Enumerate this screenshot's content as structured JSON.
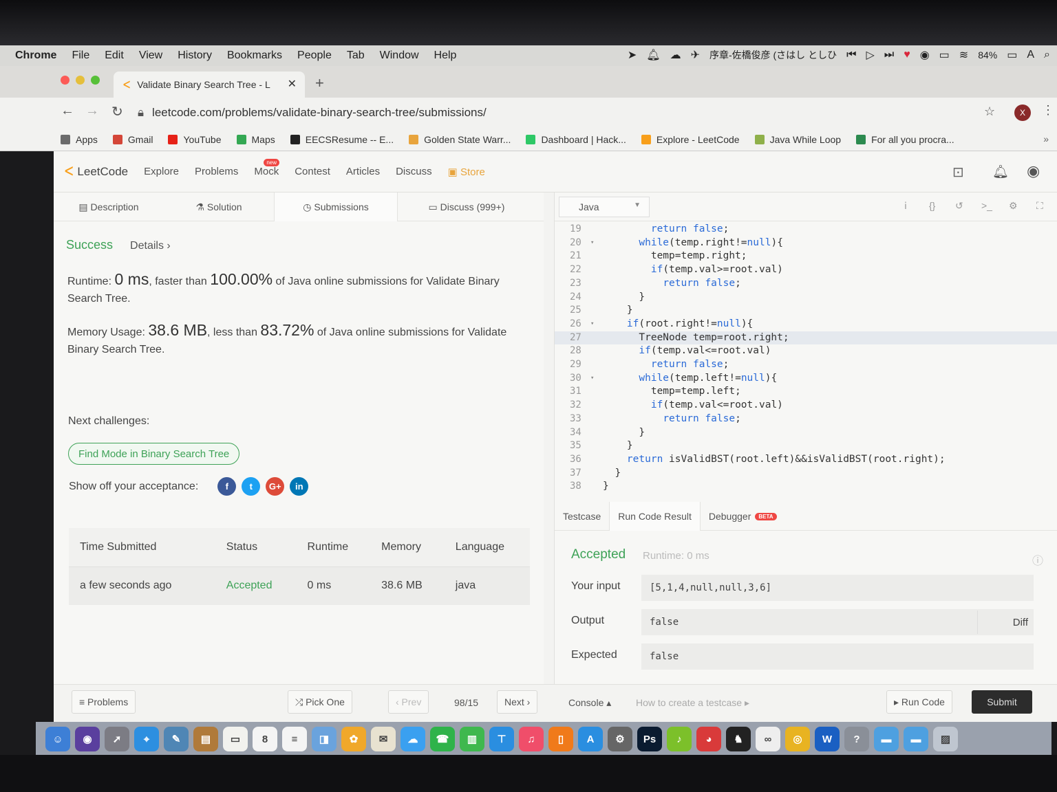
{
  "menubar": {
    "app": "Chrome",
    "items": [
      "File",
      "Edit",
      "View",
      "History",
      "Bookmarks",
      "People",
      "Tab",
      "Window",
      "Help"
    ],
    "now_playing": "序章-佐橋俊彦 (さはし としひ",
    "battery": "84%"
  },
  "browser": {
    "tab_title": "Validate Binary Search Tree - L",
    "tab_close": "✕",
    "url": "leetcode.com/problems/validate-binary-search-tree/submissions/",
    "profile_initial": "X",
    "bookmarks": [
      {
        "label": "Apps",
        "color": "#6b6b6b"
      },
      {
        "label": "Gmail",
        "color": "#d44638"
      },
      {
        "label": "YouTube",
        "color": "#e62117"
      },
      {
        "label": "Maps",
        "color": "#34a853"
      },
      {
        "label": "EECSResume -- E...",
        "color": "#222222"
      },
      {
        "label": "Golden State Warr...",
        "color": "#e8a43c"
      },
      {
        "label": "Dashboard | Hack...",
        "color": "#2ec866"
      },
      {
        "label": "Explore - LeetCode",
        "color": "#f89f1b"
      },
      {
        "label": "Java While Loop",
        "color": "#8fb04a"
      },
      {
        "label": "For all you procra...",
        "color": "#2c8a4f"
      }
    ],
    "bookmarks_overflow": "»"
  },
  "leetcode": {
    "logo": "LeetCode",
    "nav": [
      "Explore",
      "Problems",
      "Mock",
      "Contest",
      "Articles",
      "Discuss"
    ],
    "new_badge": "new",
    "store": "Store",
    "subtabs": [
      "Description",
      "Solution",
      "Submissions",
      "Discuss (999+)"
    ],
    "status": "Success",
    "details": "Details",
    "runtime": {
      "prefix": "Runtime:",
      "value": "0 ms",
      "middle": ", faster than",
      "percent": "100.00%",
      "suffix": "of Java online submissions for Validate Binary Search Tree."
    },
    "memory": {
      "prefix": "Memory Usage:",
      "value": "38.6 MB",
      "middle": ", less than",
      "percent": "83.72%",
      "suffix": "of Java online submissions for Validate Binary Search Tree."
    },
    "next_challenges": "Next challenges:",
    "challenge": "Find Mode in Binary Search Tree",
    "show_off": "Show off your acceptance:",
    "social": [
      {
        "label": "f",
        "color": "#3b5998"
      },
      {
        "label": "t",
        "color": "#1da1f2"
      },
      {
        "label": "G+",
        "color": "#dd4b39"
      },
      {
        "label": "in",
        "color": "#0077b5"
      }
    ],
    "table": {
      "headers": [
        "Time Submitted",
        "Status",
        "Runtime",
        "Memory",
        "Language"
      ],
      "row": [
        "a few seconds ago",
        "Accepted",
        "0 ms",
        "38.6 MB",
        "java"
      ]
    },
    "editor": {
      "language": "Java",
      "lines": [
        {
          "n": "19",
          "fold": "",
          "code": "        return false;"
        },
        {
          "n": "20",
          "fold": "▾",
          "code": "      while(temp.right!=null){"
        },
        {
          "n": "21",
          "fold": "",
          "code": "        temp=temp.right;"
        },
        {
          "n": "22",
          "fold": "",
          "code": "        if(temp.val>=root.val)"
        },
        {
          "n": "23",
          "fold": "",
          "code": "          return false;"
        },
        {
          "n": "24",
          "fold": "",
          "code": "      }"
        },
        {
          "n": "25",
          "fold": "",
          "code": "    }"
        },
        {
          "n": "26",
          "fold": "▾",
          "code": "    if(root.right!=null){"
        },
        {
          "n": "27",
          "fold": "",
          "code": "      TreeNode temp=root.right;"
        },
        {
          "n": "28",
          "fold": "",
          "code": "      if(temp.val<=root.val)"
        },
        {
          "n": "29",
          "fold": "",
          "code": "        return false;"
        },
        {
          "n": "30",
          "fold": "▾",
          "code": "      while(temp.left!=null){"
        },
        {
          "n": "31",
          "fold": "",
          "code": "        temp=temp.left;"
        },
        {
          "n": "32",
          "fold": "",
          "code": "        if(temp.val<=root.val)"
        },
        {
          "n": "33",
          "fold": "",
          "code": "          return false;"
        },
        {
          "n": "34",
          "fold": "",
          "code": "      }"
        },
        {
          "n": "35",
          "fold": "",
          "code": "    }"
        },
        {
          "n": "36",
          "fold": "",
          "code": "    return isValidBST(root.left)&&isValidBST(root.right);"
        },
        {
          "n": "37",
          "fold": "",
          "code": "  }"
        },
        {
          "n": "38",
          "fold": "",
          "code": "}"
        }
      ]
    },
    "console_tabs": [
      "Testcase",
      "Run Code Result",
      "Debugger"
    ],
    "beta": "BETA",
    "result": {
      "status": "Accepted",
      "runtime": "Runtime: 0 ms",
      "input_label": "Your input",
      "input": "[5,1,4,null,null,3,6]",
      "output_label": "Output",
      "output": "false",
      "expected_label": "Expected",
      "expected": "false",
      "diff": "Diff"
    },
    "bottom": {
      "problems": "≡ Problems",
      "pick_one": "⤮ Pick One",
      "prev": "‹ Prev",
      "page": "98/15",
      "next": "Next ›",
      "console": "Console ▴",
      "how_to": "How to create a testcase ▸",
      "run_code": "▸ Run Code",
      "submit": "Submit"
    }
  },
  "dock": [
    {
      "label": "☺",
      "color": "#3d7fd6"
    },
    {
      "label": "◉",
      "color": "#5a3f9e"
    },
    {
      "label": "➚",
      "color": "#7c7c84"
    },
    {
      "label": "⌖",
      "color": "#2d8fe0"
    },
    {
      "label": "✎",
      "color": "#4f86b5"
    },
    {
      "label": "▤",
      "color": "#b07a3a"
    },
    {
      "label": "▭",
      "color": "#f2f2ee"
    },
    {
      "label": "8",
      "color": "#f4f4f4"
    },
    {
      "label": "≡",
      "color": "#f4f4f4"
    },
    {
      "label": "◨",
      "color": "#6aa3dd"
    },
    {
      "label": "✿",
      "color": "#f0a82a"
    },
    {
      "label": "✉",
      "color": "#e8e2d0"
    },
    {
      "label": "☁",
      "color": "#3aa0f0"
    },
    {
      "label": "☎",
      "color": "#2fb34a"
    },
    {
      "label": "▥",
      "color": "#3fb84e"
    },
    {
      "label": "⊤",
      "color": "#2a8ee0"
    },
    {
      "label": "♫",
      "color": "#f04e6a"
    },
    {
      "label": "▯",
      "color": "#f07a1a"
    },
    {
      "label": "A",
      "color": "#2a8ee0"
    },
    {
      "label": "⚙",
      "color": "#666666"
    },
    {
      "label": "Ps",
      "color": "#0a1b30"
    },
    {
      "label": "♪",
      "color": "#7cc02a"
    },
    {
      "label": "◕",
      "color": "#d93a3a"
    },
    {
      "label": "♞",
      "color": "#222222"
    },
    {
      "label": "∞",
      "color": "#eeeeee"
    },
    {
      "label": "◎",
      "color": "#e8b321"
    },
    {
      "label": "W",
      "color": "#1a5fc2"
    },
    {
      "label": "?",
      "color": "#8a8f98"
    },
    {
      "label": "▬",
      "color": "#4ea0e0"
    },
    {
      "label": "▬",
      "color": "#4ea0e0"
    },
    {
      "label": "▨",
      "color": "#bfc6d0"
    }
  ]
}
